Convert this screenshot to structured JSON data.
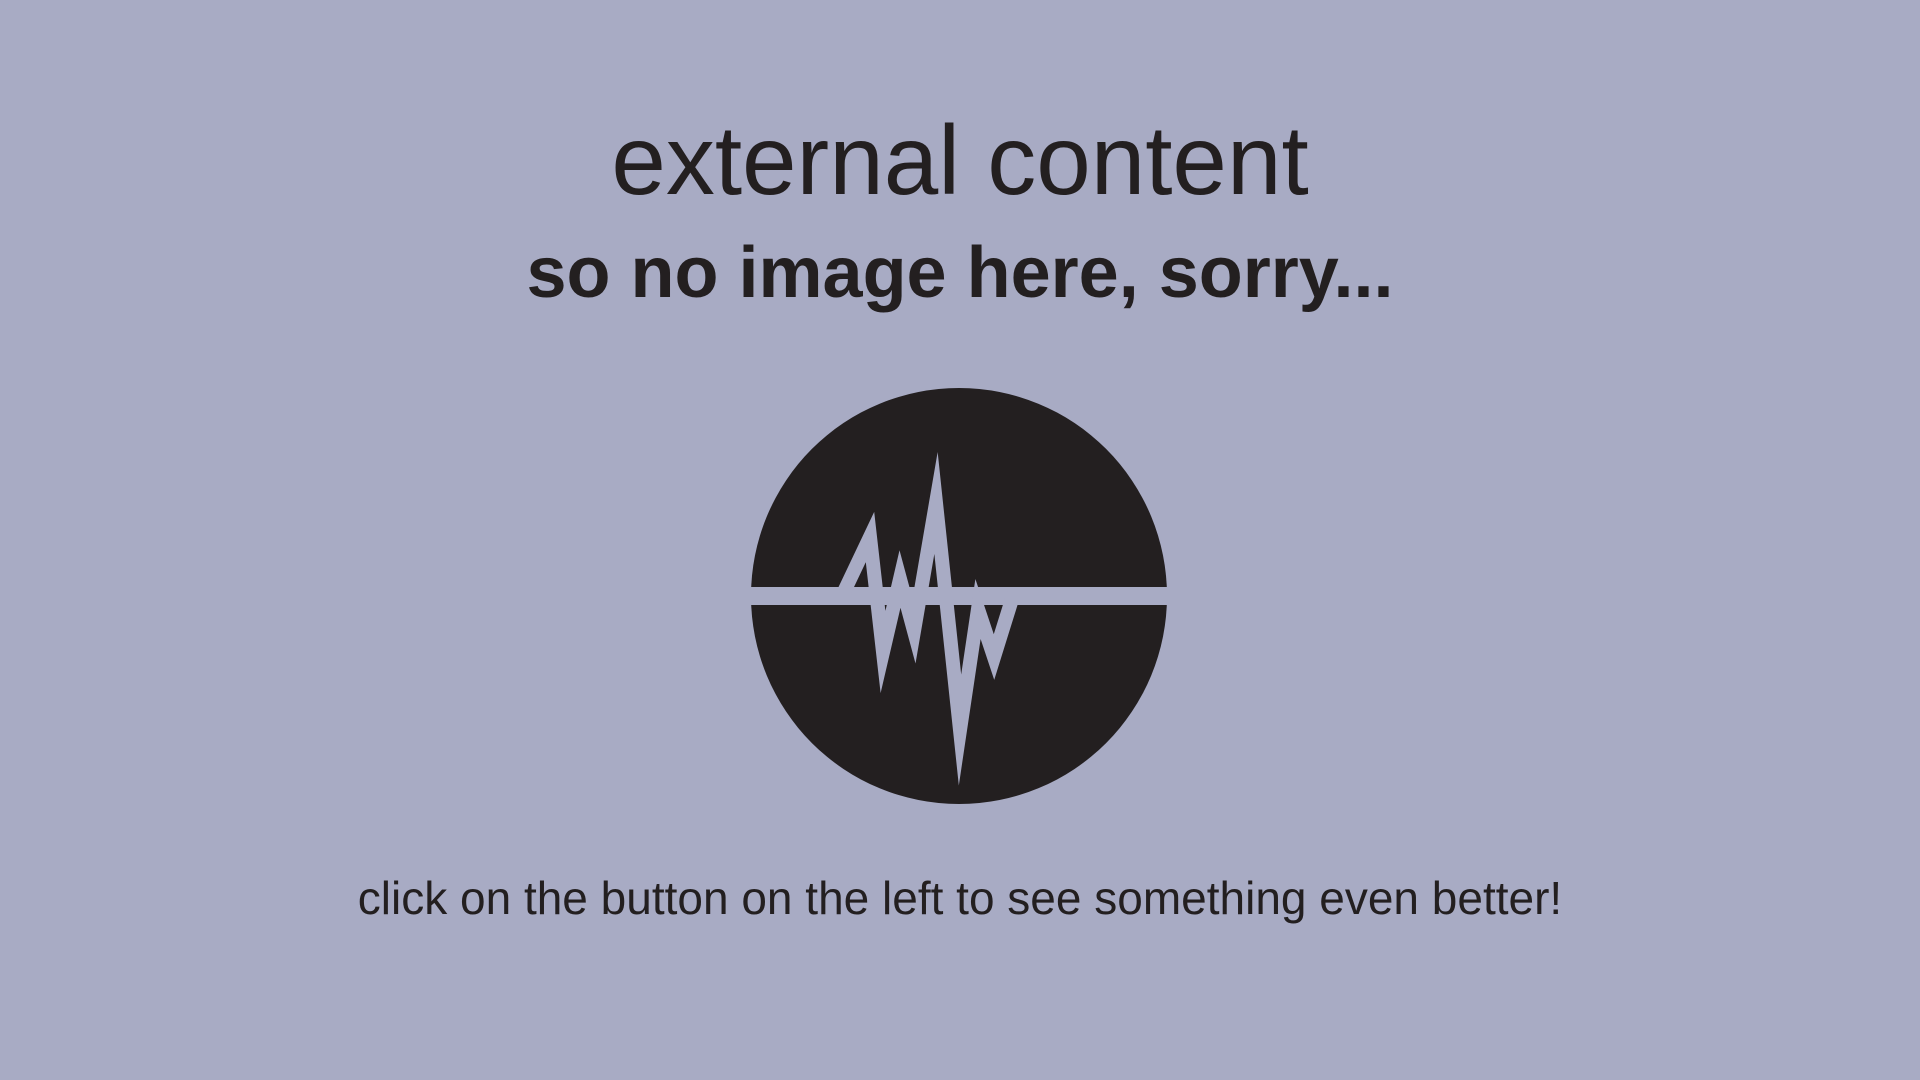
{
  "placeholder": {
    "title": "external content",
    "subtitle": "so no image here, sorry...",
    "logo_icon": "audio-waveform-icon",
    "hint": "click on the button on the left to see something even better!",
    "colors": {
      "background": "#a8abc4",
      "foreground": "#231f20"
    }
  }
}
